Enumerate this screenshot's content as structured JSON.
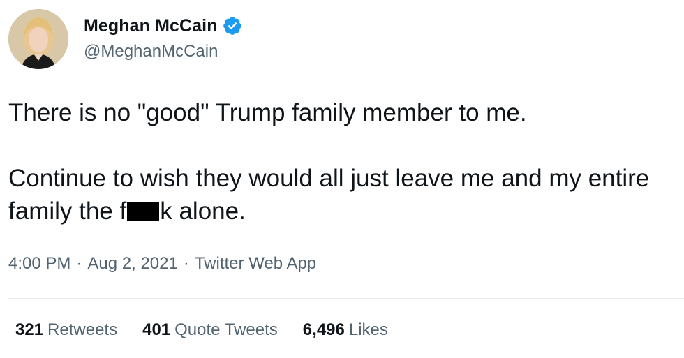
{
  "author": {
    "display_name": "Meghan McCain",
    "handle": "@MeghanMcCain",
    "verified": true
  },
  "tweet": {
    "paragraph_1": "There is no \"good\" Trump family member to me.",
    "paragraph_2_before": "Continue to wish they would all just leave me and my entire family the f",
    "paragraph_2_after": "k alone."
  },
  "meta": {
    "time": "4:00 PM",
    "separator": "·",
    "date": "Aug 2, 2021",
    "source": "Twitter Web App"
  },
  "stats": {
    "retweets_count": "321",
    "retweets_label": "Retweets",
    "quote_count": "401",
    "quote_label": "Quote Tweets",
    "likes_count": "6,496",
    "likes_label": "Likes"
  },
  "colors": {
    "text_primary": "#0f1419",
    "text_secondary": "#536471",
    "verified_blue": "#1d9bf0",
    "divider": "#e6ecf0"
  },
  "icons": {
    "verified": "verified-badge-icon",
    "avatar": "profile-avatar"
  }
}
